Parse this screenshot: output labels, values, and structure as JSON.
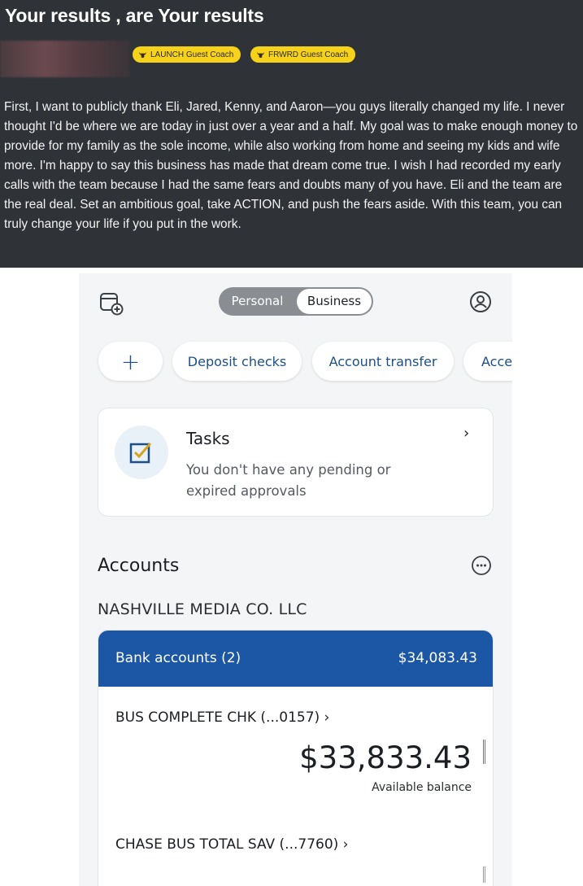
{
  "post": {
    "title": "Your results , are Your results",
    "badges": [
      "LAUNCH Guest Coach",
      "FRWRD Guest Coach"
    ],
    "body": "First, I want to publicly thank Eli, Jared, Kenny, and Aaron—you guys literally changed my life. I never thought I'd be where we are today in just over a year and a half. My goal was to make enough money to provide for my family as the sole income, while also working from home and seeing my kids and wife more. I'm happy to say this business has made that dream come true. I wish I had recorded my early calls with the team because I had the same fears and doubts many of you have. Eli and the team are the real deal. Set an ambitious goal, take ACTION, and push the fears aside. With this team, you can truly change your life if you put in the work."
  },
  "app": {
    "toggle": {
      "personal": "Personal",
      "business": "Business",
      "selected": "Business"
    },
    "quick_actions": {
      "add": "+",
      "deposit": "Deposit checks",
      "transfer": "Account transfer",
      "more": "Acce"
    },
    "tasks": {
      "title": "Tasks",
      "description": "You don't have any pending or expired approvals",
      "chevron": "›"
    },
    "accounts": {
      "title": "Accounts",
      "company": "NASHVILLE MEDIA CO. LLC",
      "group_label": "Bank accounts (2)",
      "group_total": "$34,083.43",
      "items": [
        {
          "name": "BUS COMPLETE CHK (...0157) ›",
          "balance": "$33,833.43",
          "balance_label": "Available balance"
        },
        {
          "name": "CHASE BUS TOTAL SAV (...7760) ›"
        }
      ]
    },
    "colors": {
      "brand_blue": "#1c57a6",
      "link_blue": "#1d4f87",
      "badge_yellow": "#f7d21b",
      "post_bg": "#2f3236"
    },
    "icons": [
      "new-account-icon",
      "profile-icon",
      "tasks-checkbox-icon",
      "more-options-icon",
      "chevron-right-icon",
      "bull-icon"
    ]
  }
}
